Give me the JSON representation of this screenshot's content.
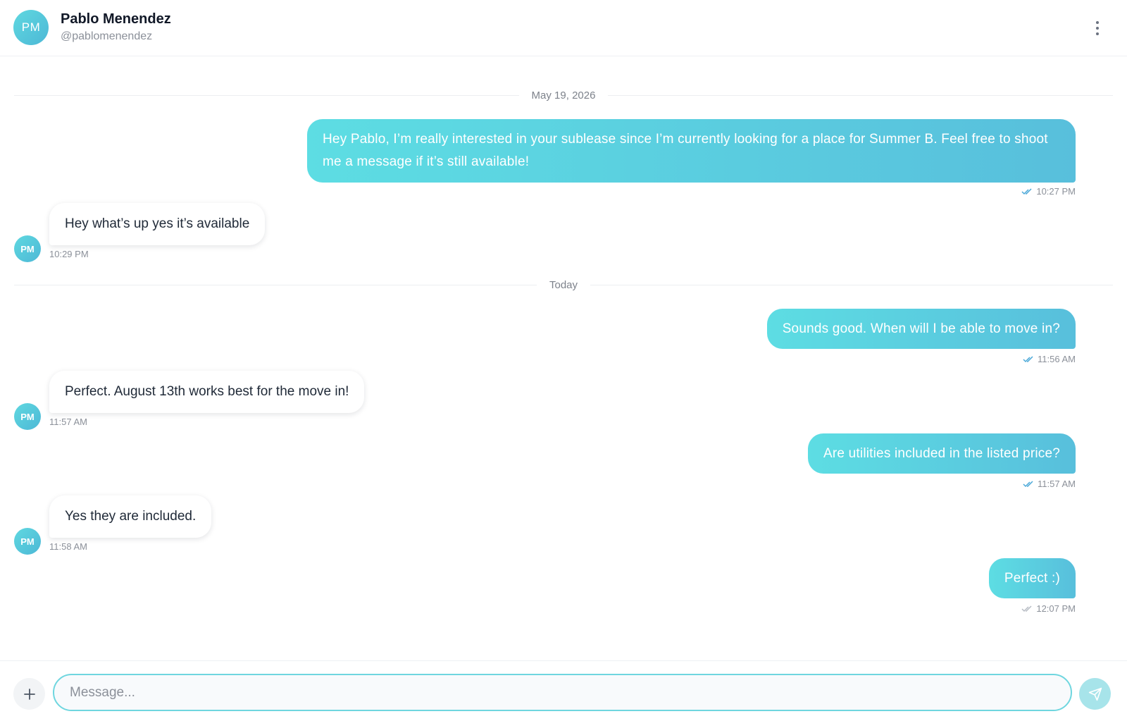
{
  "contact": {
    "initials": "PM",
    "name": "Pablo Menendez",
    "handle": "@pablomenendez"
  },
  "header": {
    "menu_icon": "more-vertical-icon"
  },
  "dividers": [
    "May 19, 2026",
    "Today"
  ],
  "messages": [
    {
      "direction": "outgoing",
      "text": "Hey Pablo, I’m really interested in your sublease since I’m currently looking for a place for Summer B. Feel free to shoot me a message if it’s still available!",
      "time": "10:27 PM",
      "status": "read"
    },
    {
      "direction": "incoming",
      "text": "Hey what’s up yes it’s available",
      "time": "10:29 PM"
    },
    {
      "direction": "outgoing",
      "text": "Sounds good. When will I be able to move in?",
      "time": "11:56 AM",
      "status": "read"
    },
    {
      "direction": "incoming",
      "text": "Perfect. August 13th works best for the move in!",
      "time": "11:57 AM"
    },
    {
      "direction": "outgoing",
      "text": "Are utilities included in the listed price?",
      "time": "11:57 AM",
      "status": "read"
    },
    {
      "direction": "incoming",
      "text": "Yes they are included.",
      "time": "11:58 AM"
    },
    {
      "direction": "outgoing",
      "text": "Perfect :)",
      "time": "12:07 PM",
      "status": "delivered"
    }
  ],
  "composer": {
    "placeholder": "Message...",
    "value": "",
    "attach_icon": "plus-icon",
    "send_icon": "send-icon"
  },
  "colors": {
    "accent_start": "#5ddde3",
    "accent_end": "#58bfdc",
    "read_check": "#4aa8d8",
    "delivered_check": "#b7bcc4"
  }
}
